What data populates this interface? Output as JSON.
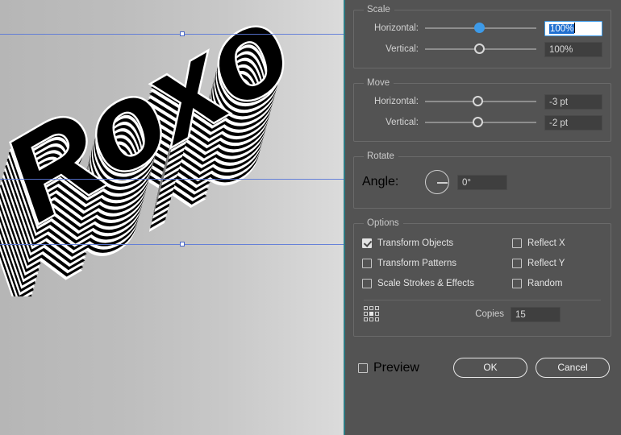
{
  "canvas": {
    "artwork_text": "Roxo",
    "description": "rotated-extruded-text-artwork",
    "background_from": "#b6b6b6",
    "background_to": "#dcdcdc",
    "guide_color": "#5a78d8"
  },
  "dialog": {
    "accent_color": "#3d9ae8",
    "panel_background": "#535353",
    "edge_color": "#2d7c85",
    "scale": {
      "legend": "Scale",
      "horizontal_label": "Horizontal:",
      "horizontal_value": "100%",
      "vertical_label": "Vertical:",
      "vertical_value": "100%"
    },
    "move": {
      "legend": "Move",
      "horizontal_label": "Horizontal:",
      "horizontal_value": "-3 pt",
      "vertical_label": "Vertical:",
      "vertical_value": "-2 pt"
    },
    "rotate": {
      "legend": "Rotate",
      "angle_label": "Angle:",
      "angle_value": "0°"
    },
    "options": {
      "legend": "Options",
      "left_column": [
        {
          "label": "Transform Objects",
          "checked": true
        },
        {
          "label": "Transform Patterns",
          "checked": false
        },
        {
          "label": "Scale Strokes & Effects",
          "checked": false
        }
      ],
      "right_column": [
        {
          "label": "Reflect X",
          "checked": false
        },
        {
          "label": "Reflect Y",
          "checked": false
        },
        {
          "label": "Random",
          "checked": false
        }
      ],
      "reference_point_icon": "reference-point-grid-icon",
      "copies_label": "Copies",
      "copies_value": "15"
    },
    "footer": {
      "preview_label": "Preview",
      "preview_checked": false,
      "ok_label": "OK",
      "cancel_label": "Cancel"
    }
  }
}
